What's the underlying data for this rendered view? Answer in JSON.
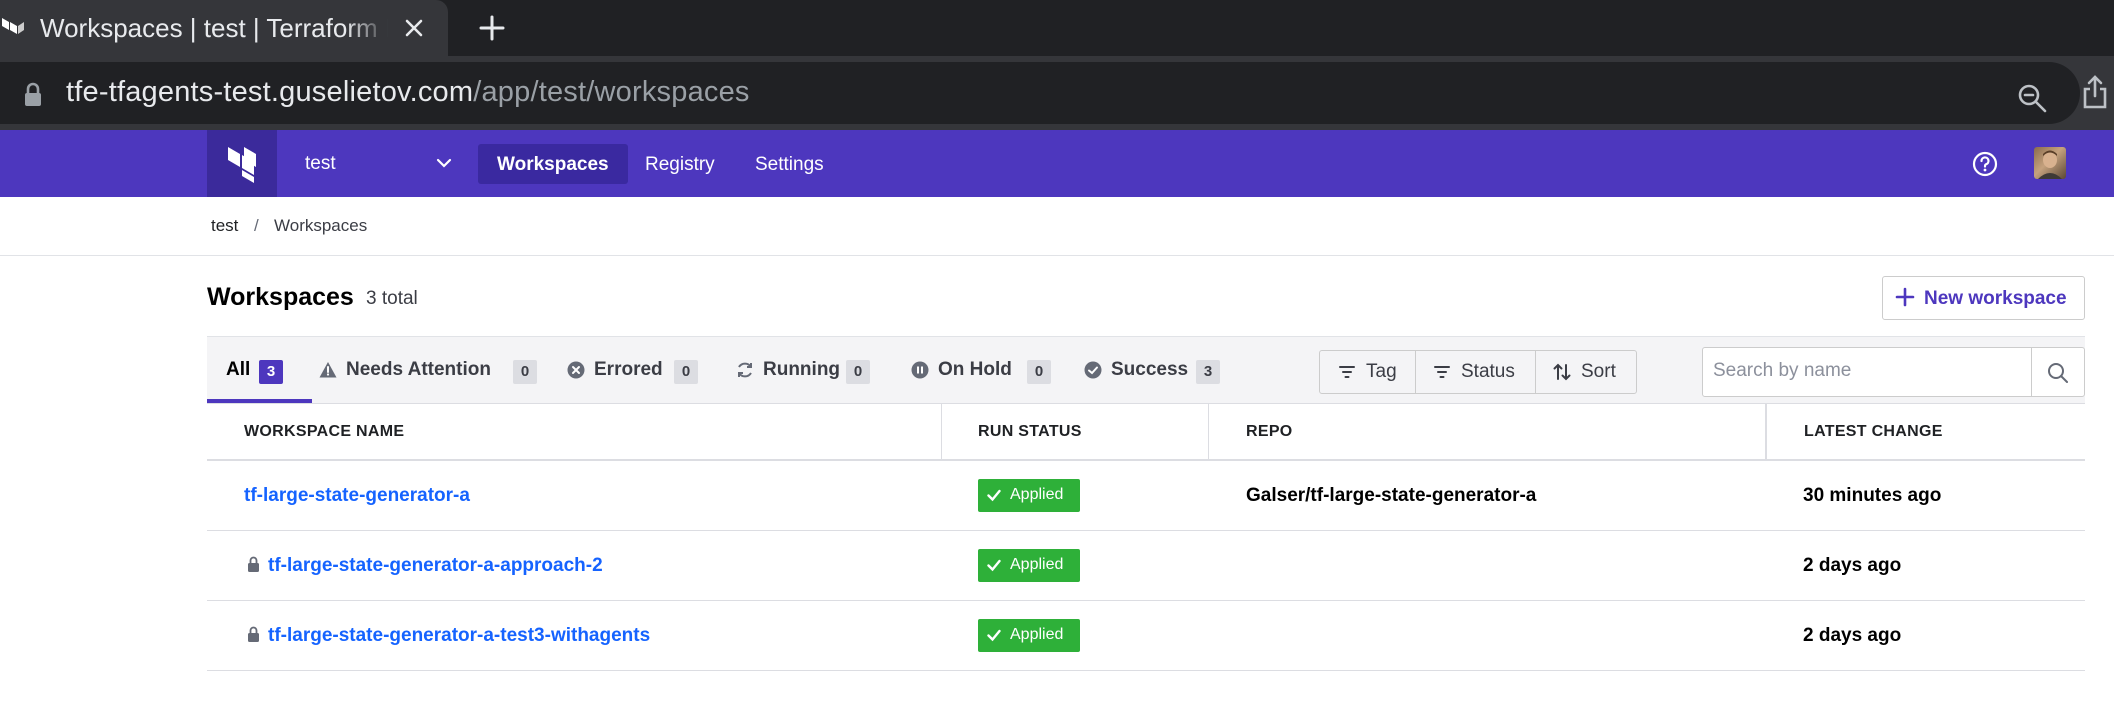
{
  "browser": {
    "tab_title": "Workspaces | test | Terraform Enterprise",
    "url_host": "tfe-tfagents-test.guselietov.com",
    "url_path": "/app/test/workspaces"
  },
  "topnav": {
    "org": "test",
    "links": [
      "Workspaces",
      "Registry",
      "Settings"
    ],
    "active": "Workspaces"
  },
  "breadcrumb": {
    "org": "test",
    "separator": "/",
    "current": "Workspaces"
  },
  "header": {
    "title": "Workspaces",
    "count": "3 total",
    "new_button": "New workspace"
  },
  "filter_tabs": [
    {
      "label": "All",
      "count": "3",
      "icon": "none"
    },
    {
      "label": "Needs Attention",
      "count": "0",
      "icon": "warning-icon"
    },
    {
      "label": "Errored",
      "count": "0",
      "icon": "error-circle-icon"
    },
    {
      "label": "Running",
      "count": "0",
      "icon": "running-icon"
    },
    {
      "label": "On Hold",
      "count": "0",
      "icon": "pause-circle-icon"
    },
    {
      "label": "Success",
      "count": "3",
      "icon": "check-circle-icon"
    }
  ],
  "filter_buttons": {
    "tag": "Tag",
    "status": "Status",
    "sort": "Sort"
  },
  "search": {
    "placeholder": "Search by name",
    "value": ""
  },
  "table": {
    "columns": [
      "WORKSPACE NAME",
      "RUN STATUS",
      "REPO",
      "LATEST CHANGE"
    ],
    "rows": [
      {
        "name": "tf-large-state-generator-a",
        "locked": false,
        "status": "Applied",
        "repo": "Galser/tf-large-state-generator-a",
        "latest_change": "30 minutes ago"
      },
      {
        "name": "tf-large-state-generator-a-approach-2",
        "locked": true,
        "status": "Applied",
        "repo": "",
        "latest_change": "2 days ago"
      },
      {
        "name": "tf-large-state-generator-a-test3-withagents",
        "locked": true,
        "status": "Applied",
        "repo": "",
        "latest_change": "2 days ago"
      }
    ]
  },
  "colors": {
    "brand": "#4d37be",
    "success": "#2eb039",
    "link": "#1563ff"
  }
}
